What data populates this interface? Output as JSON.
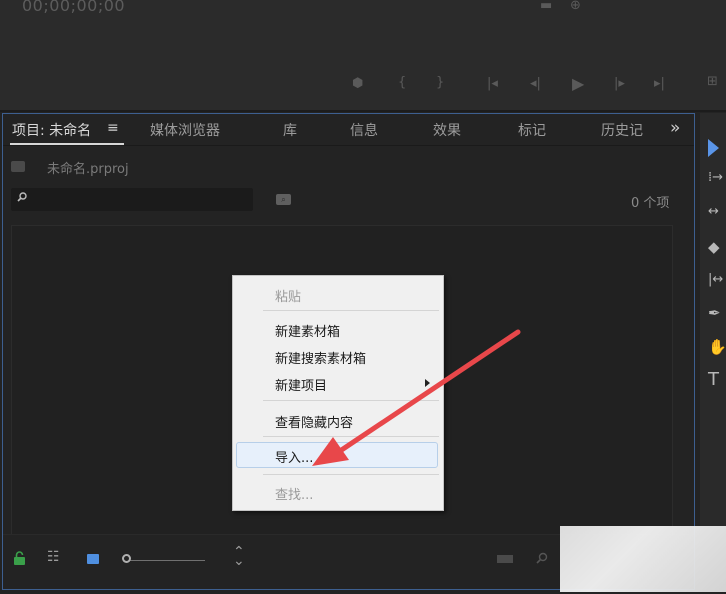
{
  "monitor": {
    "timecode": "00;00;00;00",
    "controls": [
      "marker-icon",
      "mark-in-icon",
      "mark-out-icon",
      "go-to-in-icon",
      "step-back-icon",
      "play-icon",
      "step-forward-icon",
      "go-to-out-icon",
      "more-icon"
    ]
  },
  "project_panel": {
    "tabs": [
      {
        "label": "项目: 未命名",
        "active": true
      },
      {
        "label": "媒体浏览器"
      },
      {
        "label": "库"
      },
      {
        "label": "信息"
      },
      {
        "label": "效果"
      },
      {
        "label": "标记"
      },
      {
        "label": "历史记"
      }
    ],
    "menu_glyph": "≡",
    "overflow_glyph": "»",
    "project_file": "未命名.prproj",
    "search": {
      "value": "",
      "placeholder": ""
    },
    "item_count": "0 个项"
  },
  "context_menu": {
    "items": [
      {
        "label": "粘贴",
        "enabled": false
      },
      {
        "label": "新建素材箱",
        "enabled": true
      },
      {
        "label": "新建搜索素材箱",
        "enabled": true
      },
      {
        "label": "新建项目",
        "enabled": true,
        "submenu": true
      },
      {
        "label": "查看隐藏内容",
        "enabled": true
      },
      {
        "label": "导入...",
        "enabled": true,
        "hovered": true
      },
      {
        "label": "查找...",
        "enabled": false
      }
    ]
  },
  "tools": [
    "selection-tool-icon",
    "track-select-icon",
    "ripple-edit-icon",
    "razor-icon",
    "slip-icon",
    "pen-icon",
    "hand-icon",
    "type-tool-icon"
  ],
  "colors": {
    "accent": "#4f8fe0",
    "annotation": "#e8474a",
    "panel_border": "#3d5f90",
    "lock": "#3aa04a"
  }
}
